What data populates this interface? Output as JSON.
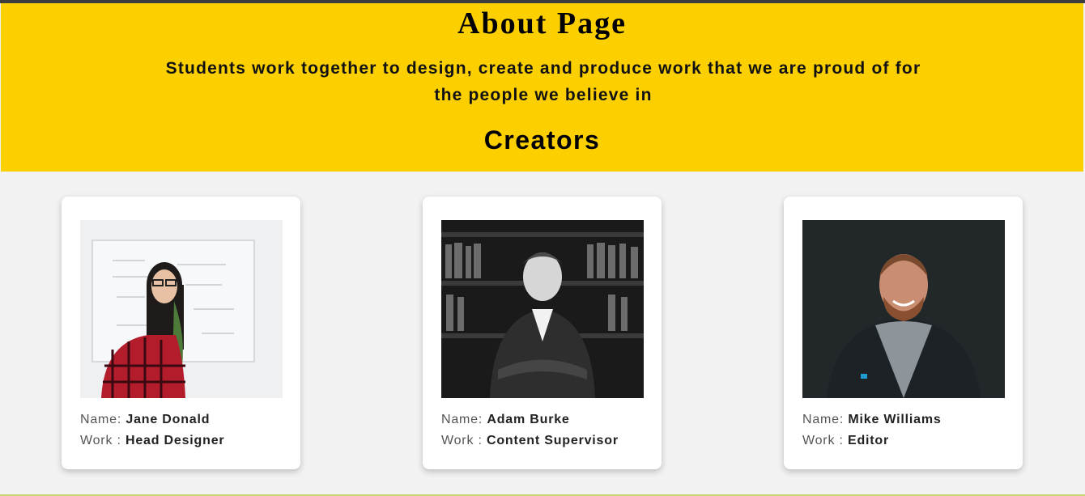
{
  "hero": {
    "title": "About Page",
    "tagline_line1": "Students work together to design, create and produce work that we are proud of for",
    "tagline_line2": "the people we believe in",
    "section_heading": "Creators"
  },
  "creators": [
    {
      "name_label": "Name:",
      "name": "Jane Donald",
      "work_label": "Work :",
      "work": "Head Designer"
    },
    {
      "name_label": "Name:",
      "name": "Adam Burke",
      "work_label": "Work :",
      "work": "Content Supervisor"
    },
    {
      "name_label": "Name:",
      "name": "Mike Williams",
      "work_label": "Work :",
      "work": "Editor"
    }
  ],
  "colors": {
    "hero_background": "#fccf00",
    "page_background": "#f2f2f2",
    "card_background": "#ffffff"
  }
}
